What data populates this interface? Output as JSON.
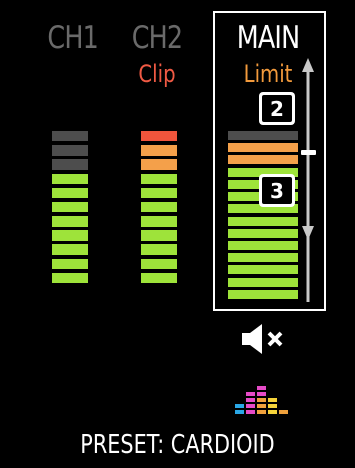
{
  "channels": [
    {
      "label": "CH1",
      "sub_label": "",
      "meter": {
        "lit_green": 8,
        "lit_orange": 0,
        "lit_red": 0,
        "total": 11
      }
    },
    {
      "label": "CH2",
      "sub_label": "Clip",
      "meter": {
        "lit_green": 8,
        "lit_orange": 2,
        "lit_red": 1,
        "total": 11
      }
    }
  ],
  "main": {
    "label": "MAIN",
    "sub_label": "Limit",
    "meter": {
      "lit_green": 11,
      "lit_orange": 2,
      "lit_red": 0,
      "total": 14
    },
    "callouts": [
      "2",
      "3"
    ]
  },
  "preset": "PRESET: CARDIOID",
  "icons": [
    "mute-speaker-icon",
    "eq-bars-icon"
  ],
  "colors": {
    "green": "#9ee33a",
    "orange": "#f4a04a",
    "red": "#f0553c",
    "unlit": "#4d4d4d",
    "label_gray": "#6a6a6a",
    "limit": "#f29a3c",
    "clip": "#f05a44"
  }
}
